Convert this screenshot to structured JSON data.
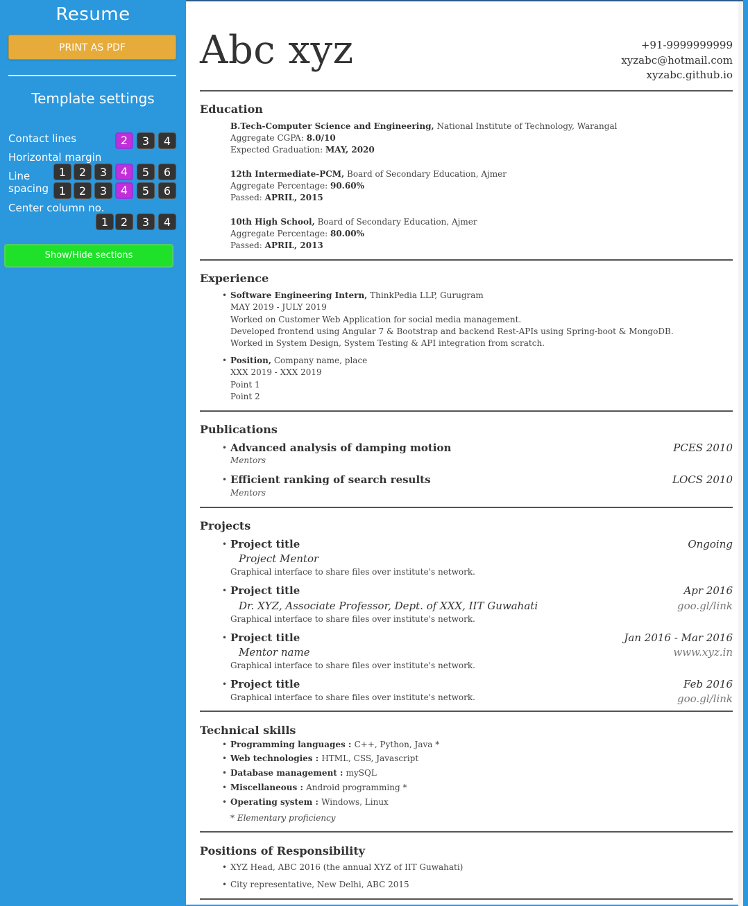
{
  "sidebar": {
    "title": "Resume",
    "print_label": "PRINT AS PDF",
    "settings_title": "Template settings",
    "contact_lines_label": "Contact lines",
    "contact_lines_options": [
      "2",
      "3",
      "4"
    ],
    "contact_lines_selected": "2",
    "horizontal_margin_label": "Horizontal margin",
    "horizontal_margin_options": [
      "1",
      "2",
      "3",
      "4",
      "5",
      "6"
    ],
    "horizontal_margin_selected": "4",
    "line_label_1": "Line",
    "line_label_2": "spacing",
    "line_spacing_options": [
      "1",
      "2",
      "3",
      "4",
      "5",
      "6"
    ],
    "line_spacing_selected": "4",
    "center_column_label": "Center column no.",
    "center_column_options": [
      "1",
      "2",
      "3",
      "4"
    ],
    "toggle_label": "Show/Hide sections",
    "accent_selected": "#c12fd8",
    "print_color": "#e7ab3a",
    "toggle_color": "#1fe12a"
  },
  "resume": {
    "name": "Abc xyz",
    "phone": "+91-9999999999",
    "email": "xyzabc@hotmail.com",
    "site": "xyzabc.github.io",
    "education": {
      "heading": "Education",
      "e1_degree": "B.Tech-Computer Science and Engineering,",
      "e1_inst": " National Institute of Technology, Warangal",
      "e1_l2_label": "Aggregate CGPA: ",
      "e1_l2_val": "8.0/10",
      "e1_l3_label": "Expected Graduation: ",
      "e1_l3_val": "MAY, 2020",
      "e2_degree": "12th Intermediate-PCM,",
      "e2_inst": " Board of Secondary Education, Ajmer",
      "e2_l2_label": "Aggregate Percentage: ",
      "e2_l2_val": "90.60%",
      "e2_l3_label": "Passed: ",
      "e2_l3_val": "APRIL, 2015",
      "e3_degree": "10th High School,",
      "e3_inst": " Board of Secondary Education, Ajmer",
      "e3_l2_label": "Aggregate Percentage: ",
      "e3_l2_val": "80.00%",
      "e3_l3_label": "Passed: ",
      "e3_l3_val": "APRIL, 2013"
    },
    "experience": {
      "heading": "Experience",
      "x1_title": "Software Engineering Intern,",
      "x1_company": " ThinkPedia LLP, Gurugram",
      "x1_dates": "MAY 2019 - JULY 2019",
      "x1_p1": "Worked on Customer Web Application for social media management.",
      "x1_p2": "Developed frontend using Angular 7 & Bootstrap and backend Rest-APIs using Spring-boot & MongoDB.",
      "x1_p3": "Worked in System Design, System Testing & API integration from scratch.",
      "x2_title": "Position,",
      "x2_company": " Company name, place",
      "x2_dates": "XXX 2019 - XXX 2019",
      "x2_p1": "Point 1",
      "x2_p2": "Point 2"
    },
    "publications": {
      "heading": "Publications",
      "p1_title": "Advanced analysis of damping motion",
      "p1_venue": "PCES 2010",
      "p1_sub": "Mentors",
      "p2_title": "Efficient ranking of search results",
      "p2_venue": "LOCS 2010",
      "p2_sub": "Mentors"
    },
    "projects": {
      "heading": "Projects",
      "j1_title": "Project title",
      "j1_date": "Ongoing",
      "j1_mentor": "Project Mentor",
      "j1_desc": "Graphical interface to share files over institute's network.",
      "j2_title": "Project title",
      "j2_date": "Apr 2016",
      "j2_mentor": "Dr. XYZ, Associate Professor, Dept. of XXX, IIT Guwahati",
      "j2_link": "goo.gl/link",
      "j2_desc": "Graphical interface to share files over institute's network.",
      "j3_title": "Project title",
      "j3_date": "Jan 2016 - Mar 2016",
      "j3_mentor": "Mentor name",
      "j3_link": "www.xyz.in",
      "j3_desc": "Graphical interface to share files over institute's network.",
      "j4_title": "Project title",
      "j4_date": "Feb 2016",
      "j4_link": "goo.gl/link",
      "j4_desc": "Graphical interface to share files over institute's network."
    },
    "skills": {
      "heading": "Technical skills",
      "s1_label": "Programming languages : ",
      "s1_val": "C++, Python, Java *",
      "s2_label": "Web technologies : ",
      "s2_val": "HTML, CSS, Javascript",
      "s3_label": "Database management : ",
      "s3_val": "mySQL",
      "s4_label": "Miscellaneous : ",
      "s4_val": "Android programming *",
      "s5_label": "Operating system : ",
      "s5_val": "Windows, Linux",
      "note": "* Elementary proficiency"
    },
    "responsibility": {
      "heading": "Positions of Responsibility",
      "r1": "XYZ Head, ABC 2016 (the annual XYZ of IIT Guwahati)",
      "r2": "City representative, New Delhi, ABC 2015"
    }
  }
}
